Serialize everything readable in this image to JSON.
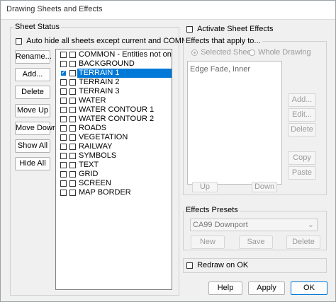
{
  "window": {
    "title": "Drawing Sheets and Effects"
  },
  "sheet_status": {
    "legend": "Sheet Status",
    "auto_hide_label": "Auto hide all sheets except current and COMMON",
    "auto_hide_checked": false,
    "buttons": {
      "rename": "Rename...",
      "add": "Add...",
      "delete": "Delete",
      "move_up": "Move Up",
      "move_down": "Move Down",
      "show_all": "Show All",
      "hide_all": "Hide All"
    },
    "sheets": [
      {
        "label": "COMMON - Entities not on any",
        "checked": false,
        "selected": false
      },
      {
        "label": "BACKGROUND",
        "checked": false,
        "selected": false
      },
      {
        "label": "TERRAIN 1",
        "checked": true,
        "selected": true
      },
      {
        "label": "TERRAIN 2",
        "checked": false,
        "selected": false
      },
      {
        "label": "TERRAIN 3",
        "checked": false,
        "selected": false
      },
      {
        "label": "WATER",
        "checked": false,
        "selected": false
      },
      {
        "label": "WATER CONTOUR 1",
        "checked": false,
        "selected": false
      },
      {
        "label": "WATER CONTOUR 2",
        "checked": false,
        "selected": false
      },
      {
        "label": "ROADS",
        "checked": false,
        "selected": false
      },
      {
        "label": "VEGETATION",
        "checked": false,
        "selected": false
      },
      {
        "label": "RAILWAY",
        "checked": false,
        "selected": false
      },
      {
        "label": "SYMBOLS",
        "checked": false,
        "selected": false
      },
      {
        "label": "TEXT",
        "checked": false,
        "selected": false
      },
      {
        "label": "GRID",
        "checked": false,
        "selected": false
      },
      {
        "label": "SCREEN",
        "checked": false,
        "selected": false
      },
      {
        "label": "MAP BORDER",
        "checked": false,
        "selected": false
      }
    ]
  },
  "effects": {
    "activate_label": "Activate Sheet Effects",
    "activate_checked": false,
    "legend": "Effects that apply to...",
    "radio_selected": "Selected Sheet",
    "radio_whole": "Whole Drawing",
    "list_items": [
      "Edge Fade, Inner"
    ],
    "buttons": {
      "add": "Add...",
      "edit": "Edit...",
      "delete": "Delete",
      "copy": "Copy",
      "paste": "Paste",
      "up": "Up",
      "down": "Down"
    }
  },
  "presets": {
    "legend": "Effects Presets",
    "selected": "CA99 Downport",
    "buttons": {
      "new": "New",
      "save": "Save",
      "delete": "Delete"
    }
  },
  "redraw": {
    "label": "Redraw on OK",
    "checked": false
  },
  "footer": {
    "help": "Help",
    "apply": "Apply",
    "ok": "OK"
  }
}
